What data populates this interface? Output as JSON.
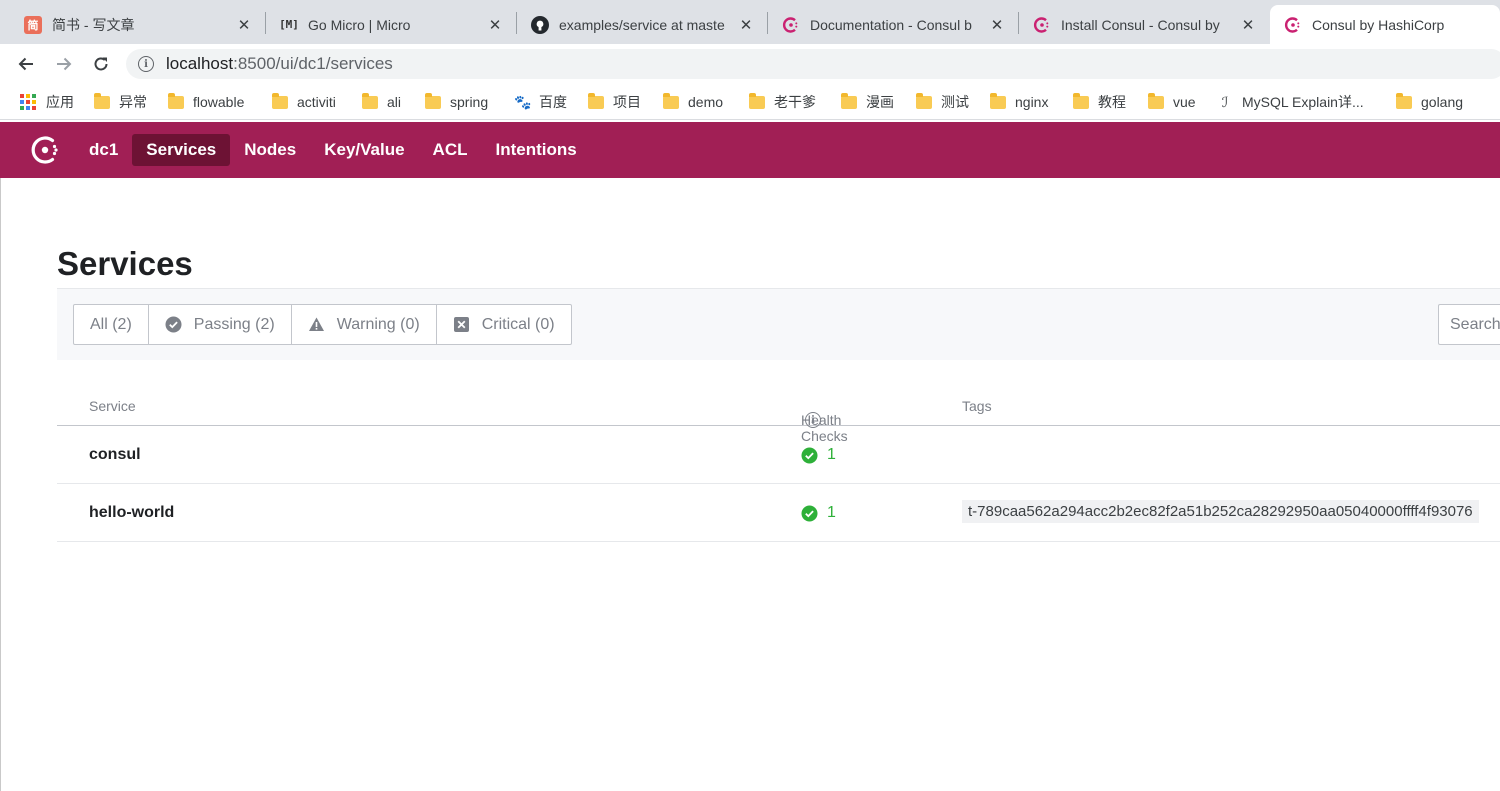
{
  "browser": {
    "tabs": [
      {
        "title": "简书 - 写文章",
        "favicon": "jianshu-icon"
      },
      {
        "title": "Go Micro | Micro",
        "favicon": "micro-icon"
      },
      {
        "title": "examples/service at maste",
        "favicon": "github-icon"
      },
      {
        "title": "Documentation - Consul b",
        "favicon": "consul-icon"
      },
      {
        "title": "Install Consul - Consul by",
        "favicon": "consul-icon"
      },
      {
        "title": "Consul by HashiCorp",
        "favicon": "consul-icon",
        "active": true
      }
    ],
    "url_host": "localhost",
    "url_rest": ":8500/ui/dc1/services",
    "bookmarks": [
      "应用",
      "异常",
      "flowable",
      "activiti",
      "ali",
      "spring",
      "百度",
      "项目",
      "demo",
      "老干爹",
      "漫画",
      "测试",
      "nginx",
      "教程",
      "vue",
      "MySQL Explain详...",
      "golang"
    ]
  },
  "consul": {
    "brand_color": "#a11f55",
    "active_nav_color": "#6d1234",
    "nav": {
      "datacenter": "dc1",
      "services": "Services",
      "nodes": "Nodes",
      "key_value": "Key/Value",
      "acl": "ACL",
      "intentions": "Intentions"
    },
    "page_title": "Services",
    "filters": {
      "all": "All (2)",
      "passing": "Passing (2)",
      "warning": "Warning (0)",
      "critical": "Critical (0)"
    },
    "search_placeholder": "Search",
    "table": {
      "headers": {
        "service": "Service",
        "health": "Health Checks",
        "tags": "Tags"
      },
      "rows": [
        {
          "name": "consul",
          "passing": "1",
          "tag": ""
        },
        {
          "name": "hello-world",
          "passing": "1",
          "tag": "t-789caa562a294acc2b2ec82f2a51b252ca28292950aa05040000ffff4f93076"
        }
      ]
    },
    "status_color_passing": "#2eb039"
  }
}
